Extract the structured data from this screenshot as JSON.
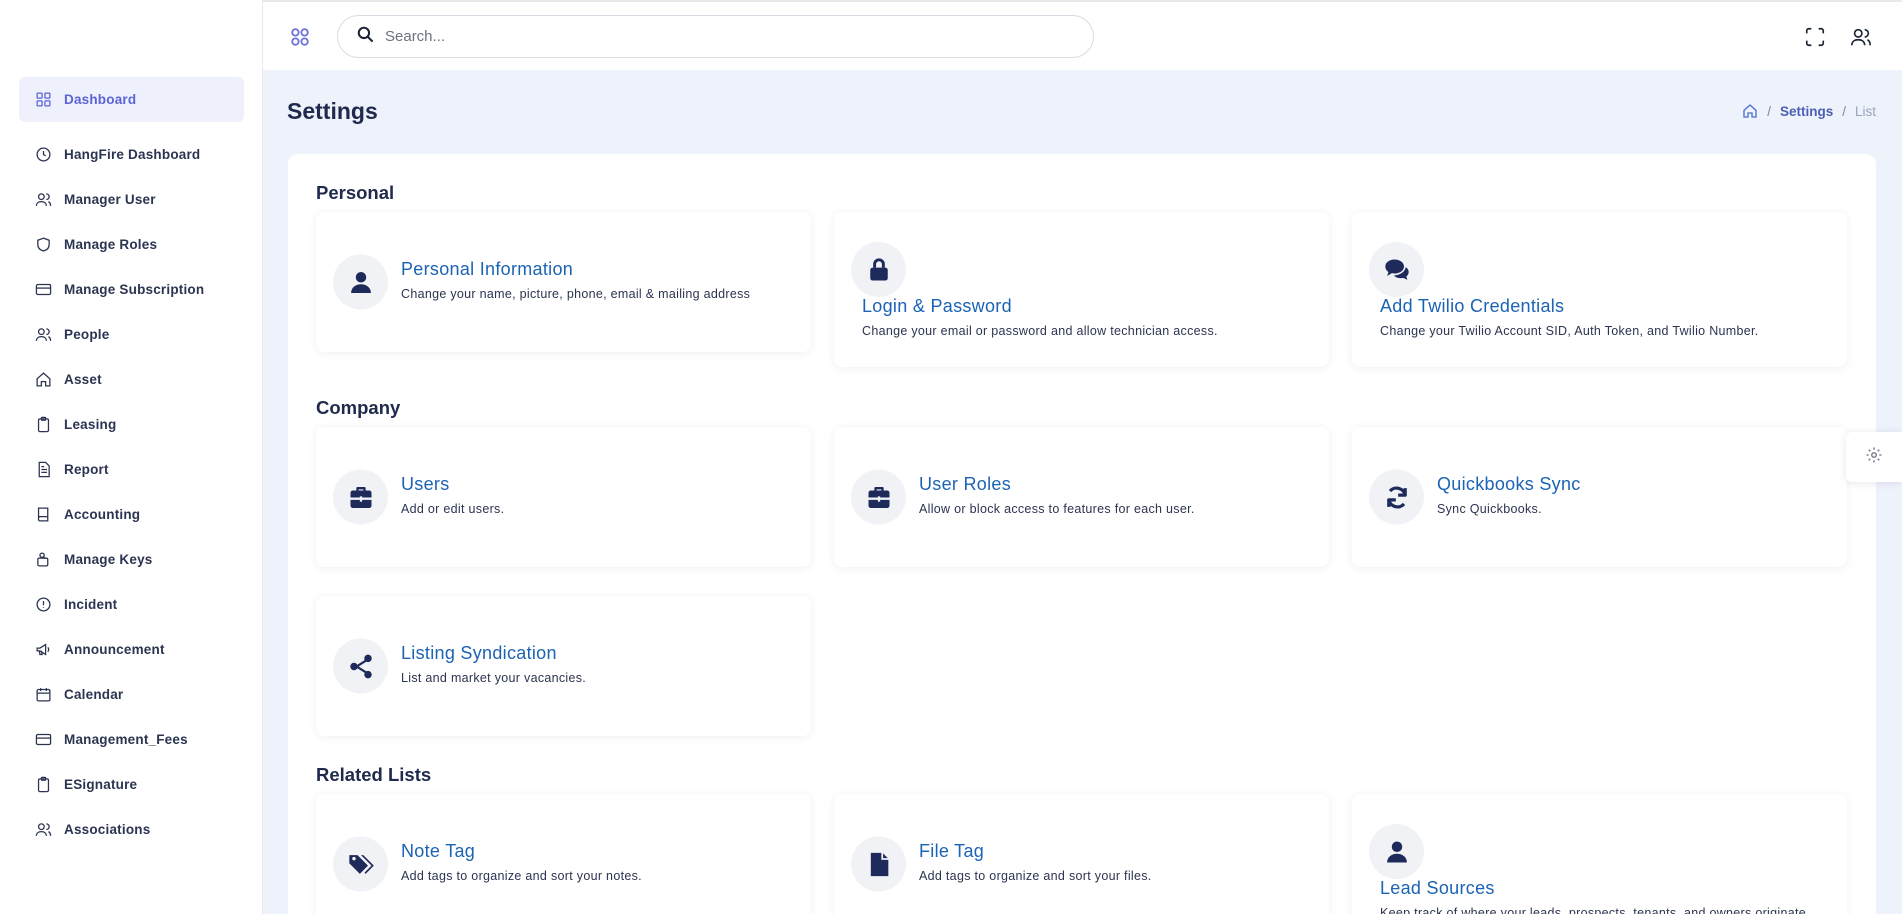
{
  "sidebar": {
    "items": [
      {
        "label": "Dashboard",
        "icon": "grid-icon",
        "active": true
      },
      {
        "label": "HangFire Dashboard",
        "icon": "clock-icon"
      },
      {
        "label": "Manager User",
        "icon": "users-icon"
      },
      {
        "label": "Manage Roles",
        "icon": "shield-icon"
      },
      {
        "label": "Manage Subscription",
        "icon": "card-icon"
      },
      {
        "label": "People",
        "icon": "users-icon"
      },
      {
        "label": "Asset",
        "icon": "home-icon"
      },
      {
        "label": "Leasing",
        "icon": "clipboard-icon"
      },
      {
        "label": "Report",
        "icon": "document-icon"
      },
      {
        "label": "Accounting",
        "icon": "book-icon"
      },
      {
        "label": "Manage Keys",
        "icon": "key-icon"
      },
      {
        "label": "Incident",
        "icon": "alert-circle-icon"
      },
      {
        "label": "Announcement",
        "icon": "megaphone-icon"
      },
      {
        "label": "Calendar",
        "icon": "calendar-icon"
      },
      {
        "label": "Management_Fees",
        "icon": "card-icon"
      },
      {
        "label": "ESignature",
        "icon": "clipboard-icon"
      },
      {
        "label": "Associations",
        "icon": "users-icon"
      }
    ]
  },
  "topbar": {
    "search_placeholder": "Search..."
  },
  "page": {
    "title": "Settings",
    "breadcrumb": {
      "link": "Settings",
      "current": "List"
    }
  },
  "sections": {
    "personal": {
      "title": "Personal",
      "tiles": [
        {
          "title": "Personal Information",
          "desc": "Change your name, picture, phone, email & mailing address",
          "icon": "user-icon"
        },
        {
          "title": "Login & Password",
          "desc": "Change your email or password and allow technician access.",
          "icon": "lock-icon"
        },
        {
          "title": "Add Twilio Credentials",
          "desc": "Change your Twilio Account SID, Auth Token, and Twilio Number.",
          "icon": "chat-bubbles-icon"
        }
      ]
    },
    "company": {
      "title": "Company",
      "tiles": [
        {
          "title": "Users",
          "desc": "Add or edit users.",
          "icon": "briefcase-icon"
        },
        {
          "title": "User Roles",
          "desc": "Allow or block access to features for each user.",
          "icon": "briefcase-icon"
        },
        {
          "title": "Quickbooks Sync",
          "desc": "Sync Quickbooks.",
          "icon": "sync-icon"
        },
        {
          "title": "Listing Syndication",
          "desc": "List and market your vacancies.",
          "icon": "share-icon"
        }
      ]
    },
    "related": {
      "title": "Related Lists",
      "tiles": [
        {
          "title": "Note Tag",
          "desc": "Add tags to organize and sort your notes.",
          "icon": "tags-icon"
        },
        {
          "title": "File Tag",
          "desc": "Add tags to organize and sort your files.",
          "icon": "file-icon"
        },
        {
          "title": "Lead Sources",
          "desc": "Keep track of where your leads, prospects, tenants, and owners originate.",
          "icon": "user-icon"
        }
      ]
    }
  },
  "colors": {
    "accent": "#5b63d6",
    "link": "#1b63b4",
    "icon_dark": "#1d2a5a",
    "background": "#eef2fb"
  }
}
